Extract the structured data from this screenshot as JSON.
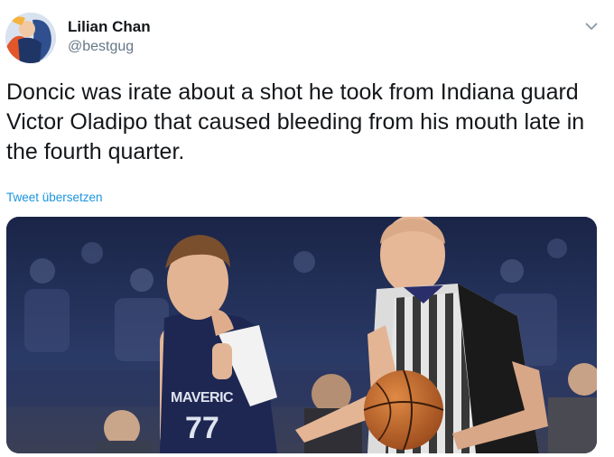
{
  "user": {
    "display_name": "Lilian Chan",
    "handle": "@bestgug"
  },
  "tweet": {
    "text": "Doncic was irate about a shot he took from Indiana guard Victor Oladipo that caused bleeding from his mouth late in the fourth quarter.",
    "translate_link": "Tweet übersetzen"
  },
  "photo": {
    "jersey_text": "MAVERIC",
    "jersey_number": "77"
  },
  "icons": {
    "menu": "chevron-down-icon"
  },
  "colors": {
    "text": "#14171a",
    "secondary": "#657786",
    "link": "#1b95e0"
  }
}
